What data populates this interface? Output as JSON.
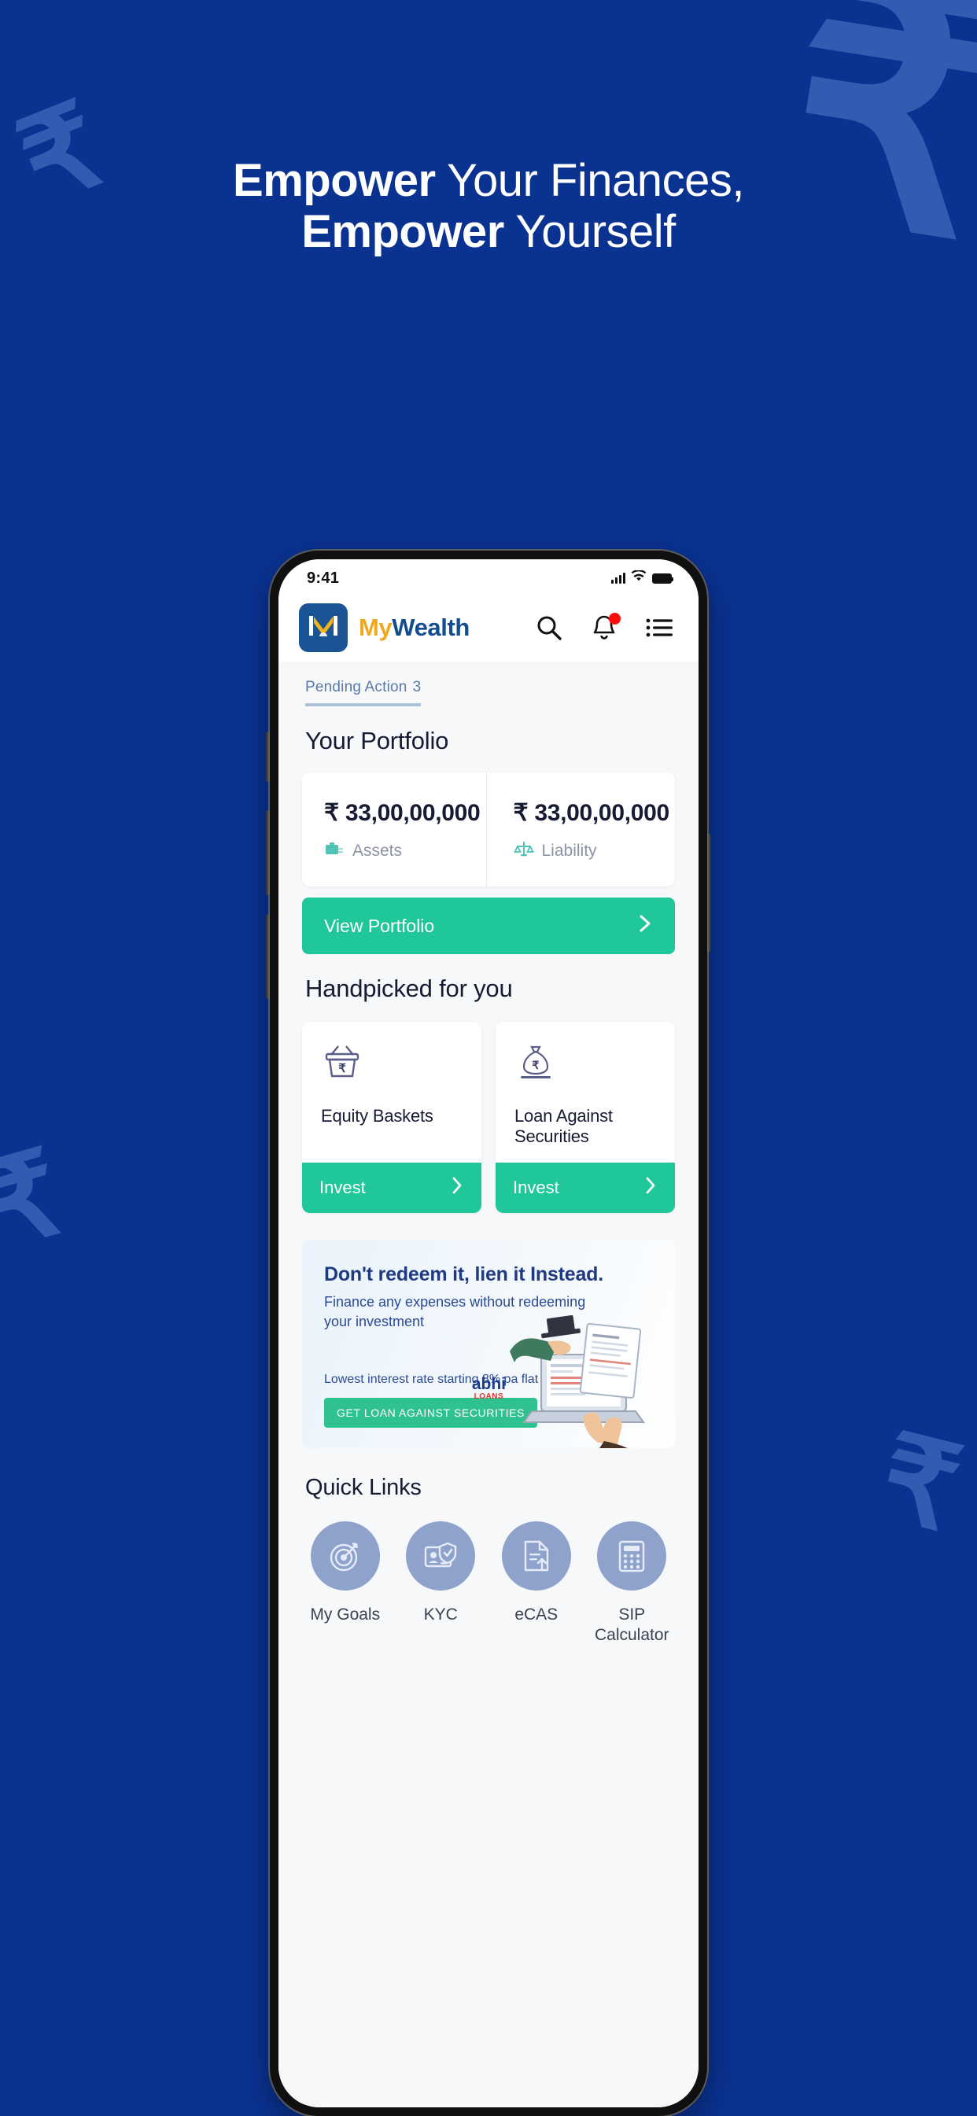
{
  "hero": {
    "line1_bold": "Empower",
    "line1_rest": " Your Finances,",
    "line2_bold": "Empower",
    "line2_rest": " Yourself"
  },
  "status_bar": {
    "time": "9:41"
  },
  "app_header": {
    "logo_letter": "M",
    "brand_first": "My",
    "brand_second": "Wealth",
    "search_icon": "search-icon",
    "bell_icon": "bell-icon",
    "menu_icon": "list-menu-icon"
  },
  "tabs": {
    "pending_label": "Pending Action",
    "pending_count": "3"
  },
  "portfolio": {
    "title": "Your Portfolio",
    "columns": [
      {
        "amount": "₹ 33,00,00,000",
        "label": "Assets",
        "icon": "briefcase-icon"
      },
      {
        "amount": "₹ 33,00,00,000",
        "label": "Liability",
        "icon": "scale-icon"
      }
    ],
    "cta_label": "View Portfolio",
    "cta_icon": "chevron-right-icon"
  },
  "handpicked": {
    "title": "Handpicked for you",
    "cards": [
      {
        "name": "Equity Baskets",
        "icon": "basket-rupee-icon",
        "cta": "Invest"
      },
      {
        "name": "Loan Against Securities",
        "icon": "money-bag-icon",
        "cta": "Invest"
      }
    ]
  },
  "banner": {
    "heading": "Don't redeem it, lien it Instead.",
    "sub_line1": "Finance any expenses without redeeming",
    "sub_line2": "your investment",
    "rate_text": "Lowest interest rate starting 8% pa flat",
    "cta": "GET LOAN AGAINST SECURITIES",
    "badge_top": "abhi",
    "badge_bottom": "LOANS"
  },
  "quick_links": {
    "title": "Quick Links",
    "items": [
      {
        "label": "My Goals",
        "icon": "target-icon"
      },
      {
        "label": "KYC",
        "icon": "id-card-shield-icon"
      },
      {
        "label": "eCAS",
        "icon": "document-upload-icon"
      },
      {
        "label": "SIP Calculator",
        "icon": "calculator-icon"
      }
    ]
  },
  "colors": {
    "background_blue": "#0A3291",
    "accent_green": "#1FC79B",
    "brand_orange": "#F0A81E",
    "brand_blue": "#134C8F",
    "notification_red": "#FF0B0B"
  }
}
